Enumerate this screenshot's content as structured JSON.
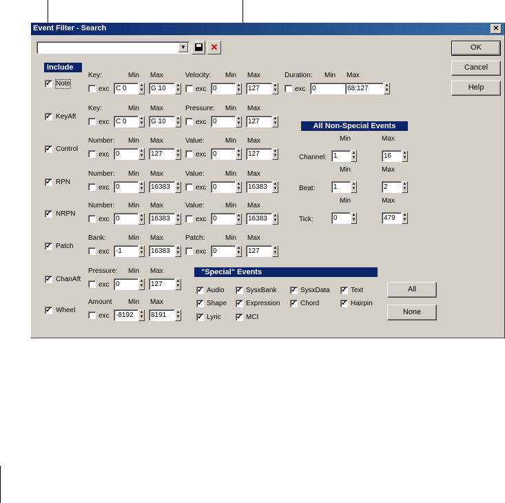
{
  "dialog": {
    "title": "Event Filter - Search",
    "close": "✕"
  },
  "toolbar": {
    "preset_value": "",
    "combo_arrow": "▼",
    "save_icon": "💾",
    "delete_icon": "✕"
  },
  "buttons": {
    "ok": "OK",
    "cancel": "Cancel",
    "help": "Help",
    "all": "All",
    "none": "None"
  },
  "include_header": "Include",
  "common": {
    "min": "Min",
    "max": "Max",
    "exc": "exc"
  },
  "rows": [
    {
      "name": "Note",
      "checked": true,
      "f1": "Key:",
      "f1_min": "C 0",
      "f1_max": "G 10",
      "f2": "Velocity:",
      "f2_min": "0",
      "f2_max": "127",
      "f3": "Duration:",
      "f3_min": "0",
      "f3_max": "68:127"
    },
    {
      "name": "KeyAft",
      "checked": true,
      "f1": "Key:",
      "f1_min": "C 0",
      "f1_max": "G 10",
      "f2": "Pressure:",
      "f2_min": "0",
      "f2_max": "127"
    },
    {
      "name": "Control",
      "checked": true,
      "f1": "Number:",
      "f1_min": "0",
      "f1_max": "127",
      "f2": "Value:",
      "f2_min": "0",
      "f2_max": "127"
    },
    {
      "name": "RPN",
      "checked": true,
      "f1": "Number:",
      "f1_min": "0",
      "f1_max": "16383",
      "f2": "Value:",
      "f2_min": "0",
      "f2_max": "16383"
    },
    {
      "name": "NRPN",
      "checked": true,
      "f1": "Number:",
      "f1_min": "0",
      "f1_max": "16383",
      "f2": "Value:",
      "f2_min": "0",
      "f2_max": "16383"
    },
    {
      "name": "Patch",
      "checked": true,
      "f1": "Bank:",
      "f1_min": "-1",
      "f1_max": "16383",
      "f2": "Patch:",
      "f2_min": "0",
      "f2_max": "127"
    },
    {
      "name": "ChanAft",
      "checked": true,
      "f1": "Pressure:",
      "f1_min": "0",
      "f1_max": "127"
    },
    {
      "name": "Wheel",
      "checked": true,
      "f1": "Amount",
      "f1_min": "-8192",
      "f1_max": "8191"
    }
  ],
  "nonspecial": {
    "header": "All Non-Special Events",
    "channel": {
      "label": "Channel:",
      "min": "1",
      "max": "16"
    },
    "beat": {
      "label": "Beat:",
      "min": "1",
      "max": "2"
    },
    "tick": {
      "label": "Tick:",
      "min": "0",
      "max": "479"
    }
  },
  "special": {
    "header": "\"Special\" Events",
    "items": [
      {
        "label": "Audio",
        "checked": true
      },
      {
        "label": "SysxBank",
        "checked": true
      },
      {
        "label": "SysxData",
        "checked": true
      },
      {
        "label": "Text",
        "checked": true
      },
      {
        "label": "Shape",
        "checked": true
      },
      {
        "label": "Expression",
        "checked": true
      },
      {
        "label": "Chord",
        "checked": true
      },
      {
        "label": "Hairpin",
        "checked": true
      },
      {
        "label": "Lyric",
        "checked": true
      },
      {
        "label": "MCI",
        "checked": true
      }
    ]
  }
}
